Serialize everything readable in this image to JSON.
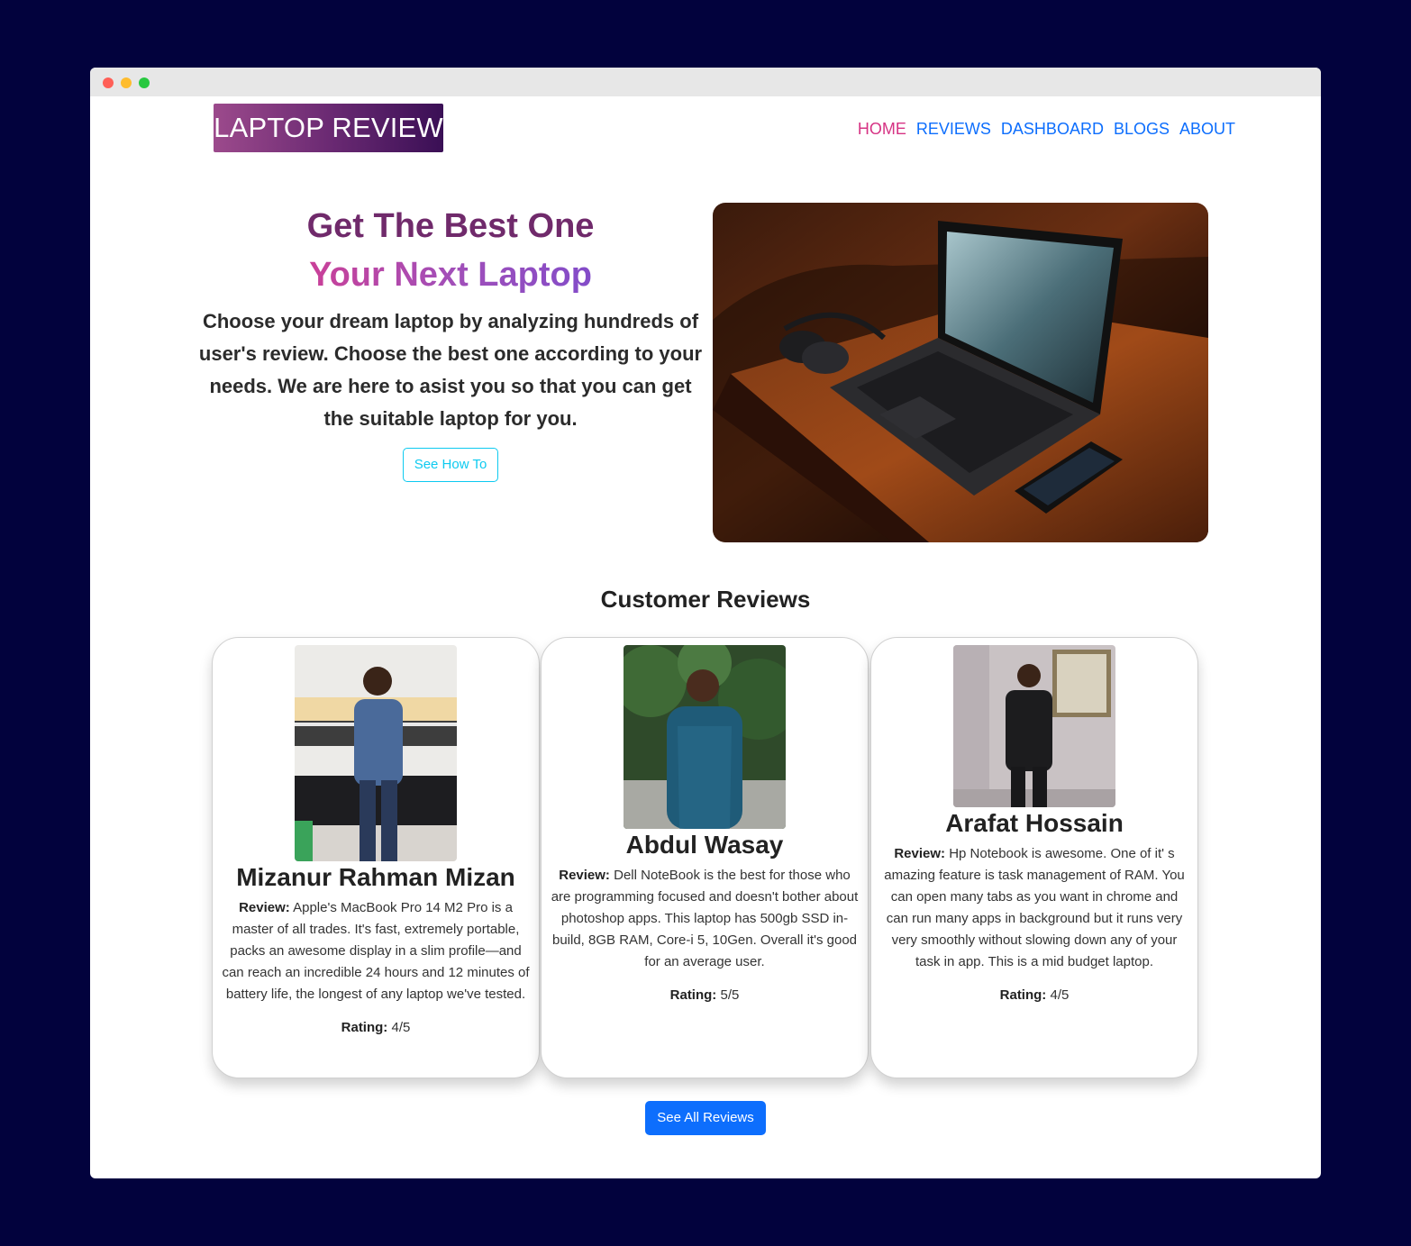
{
  "brand": {
    "logo_text": "LAPTOP REVIEW"
  },
  "nav": {
    "items": [
      {
        "label": "HOME",
        "active": true
      },
      {
        "label": "REVIEWS",
        "active": false
      },
      {
        "label": "DASHBOARD",
        "active": false
      },
      {
        "label": "BLOGS",
        "active": false
      },
      {
        "label": "ABOUT",
        "active": false
      }
    ]
  },
  "hero": {
    "title_line1": "Get The Best One",
    "title_line2": "Your Next Laptop",
    "description": "Choose your dream laptop by analyzing hundreds of user's review. Choose the best one according to your needs. We are here to asist you so that you can get the suitable laptop for you.",
    "button_label": "See How To"
  },
  "reviews_section": {
    "title": "Customer Reviews",
    "review_prefix": "Review:",
    "rating_prefix": "Rating:",
    "cards": [
      {
        "name": "Mizanur Rahman Mizan",
        "review": "Apple's MacBook Pro 14 M2 Pro is a master of all trades. It's fast, extremely portable, packs an awesome display in a slim profile—and can reach an incredible 24 hours and 12 minutes of battery life, the longest of any laptop we've tested.",
        "rating": "4/5"
      },
      {
        "name": "Abdul Wasay",
        "review": "Dell NoteBook is the best for those who are programming focused and doesn't bother about photoshop apps. This laptop has 500gb SSD in-build, 8GB RAM, Core-i 5, 10Gen. Overall it's good for an average user.",
        "rating": "5/5"
      },
      {
        "name": "Arafat Hossain",
        "review": "Hp Notebook is awesome. One of it' s amazing feature is task management of RAM. You can open many tabs as you want in chrome and can run many apps in background but it runs very very smoothly without slowing down any of your task in app. This is a mid budget laptop.",
        "rating": "4/5"
      }
    ],
    "see_all_label": "See All Reviews"
  },
  "colors": {
    "page_background": "#02023d",
    "nav_active": "#d63384",
    "nav_link": "#0d6efd",
    "primary_button": "#0d6efd",
    "outline_button": "#0dcaf0"
  }
}
